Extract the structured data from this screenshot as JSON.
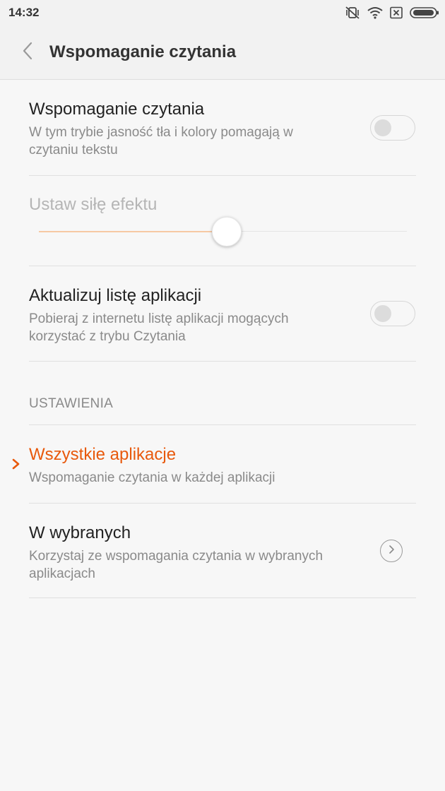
{
  "status_bar": {
    "time": "14:32",
    "icons": [
      "mute-vibrate-icon",
      "wifi-icon",
      "sim-x-icon",
      "battery-icon"
    ]
  },
  "header": {
    "back_icon": "chevron-left-icon",
    "title": "Wspomaganie czytania"
  },
  "reading_mode": {
    "title": "Wspomaganie czytania",
    "description": "W tym trybie jasność tła i kolory pomagają w czytaniu tekstu",
    "enabled": false
  },
  "effect_strength": {
    "label": "Ustaw siłę efektu",
    "value_fraction": 0.51,
    "disabled": true
  },
  "update_app_list": {
    "title": "Aktualizuj listę aplikacji",
    "description": "Pobieraj z internetu listę aplikacji mogących korzystać z trybu Czytania",
    "enabled": false
  },
  "settings_section": {
    "header": "USTAWIENIA",
    "options": [
      {
        "title": "Wszystkie aplikacje",
        "description": "Wspomaganie czytania w każdej aplikacji",
        "selected": true
      },
      {
        "title": "W wybranych",
        "description": "Korzystaj ze wspomagania czytania w wybranych aplikacjach",
        "selected": false,
        "action_icon": "chevron-right-circle-icon"
      }
    ]
  },
  "colors": {
    "accent": "#e8590c",
    "slider_fill": "#f6c9a3",
    "background": "#f7f7f7",
    "header_background": "#f2f2f2"
  }
}
